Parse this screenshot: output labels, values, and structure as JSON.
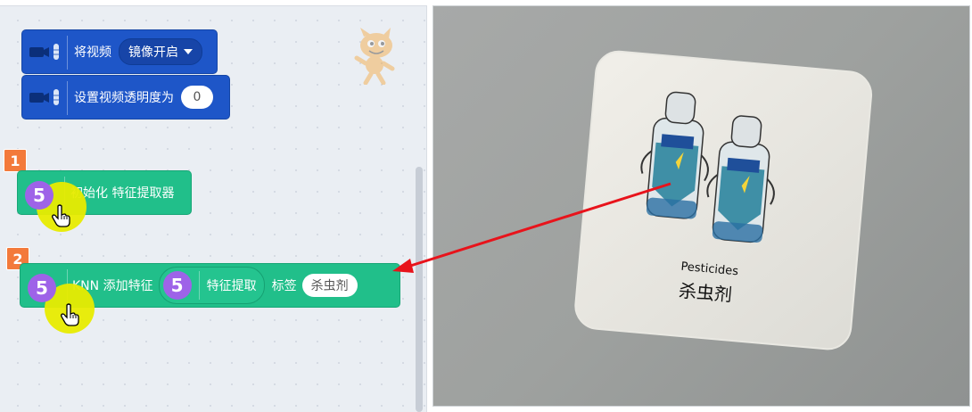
{
  "blocks": {
    "mirror_video": {
      "text": "将视频",
      "dropdown": "镜像开启"
    },
    "video_transparency": {
      "text": "设置视频透明度为",
      "value": "0"
    },
    "init_extractor": {
      "text": "初始化 特征提取器",
      "reporter_value": "5"
    },
    "knn_add": {
      "text": "KNN 添加特征",
      "reporter_value": "5",
      "inner_number": "5",
      "inner_text": "特征提取",
      "label_text": "标签",
      "label_value": "杀虫剂"
    }
  },
  "badges": [
    "1",
    "2"
  ],
  "card": {
    "label_en": "Pesticides",
    "label_cn": "杀虫剂",
    "icon_text": "杀虫剂"
  },
  "colors": {
    "video_block": "#1e56c8",
    "knn_block": "#21bf8a",
    "badge": "#f37a3b",
    "highlight": "#e8eb00",
    "arrow": "#e8131b"
  },
  "icons": [
    "camera-icon",
    "scratch-cat-icon",
    "hand-pointer-icon",
    "dropdown-caret-icon"
  ]
}
